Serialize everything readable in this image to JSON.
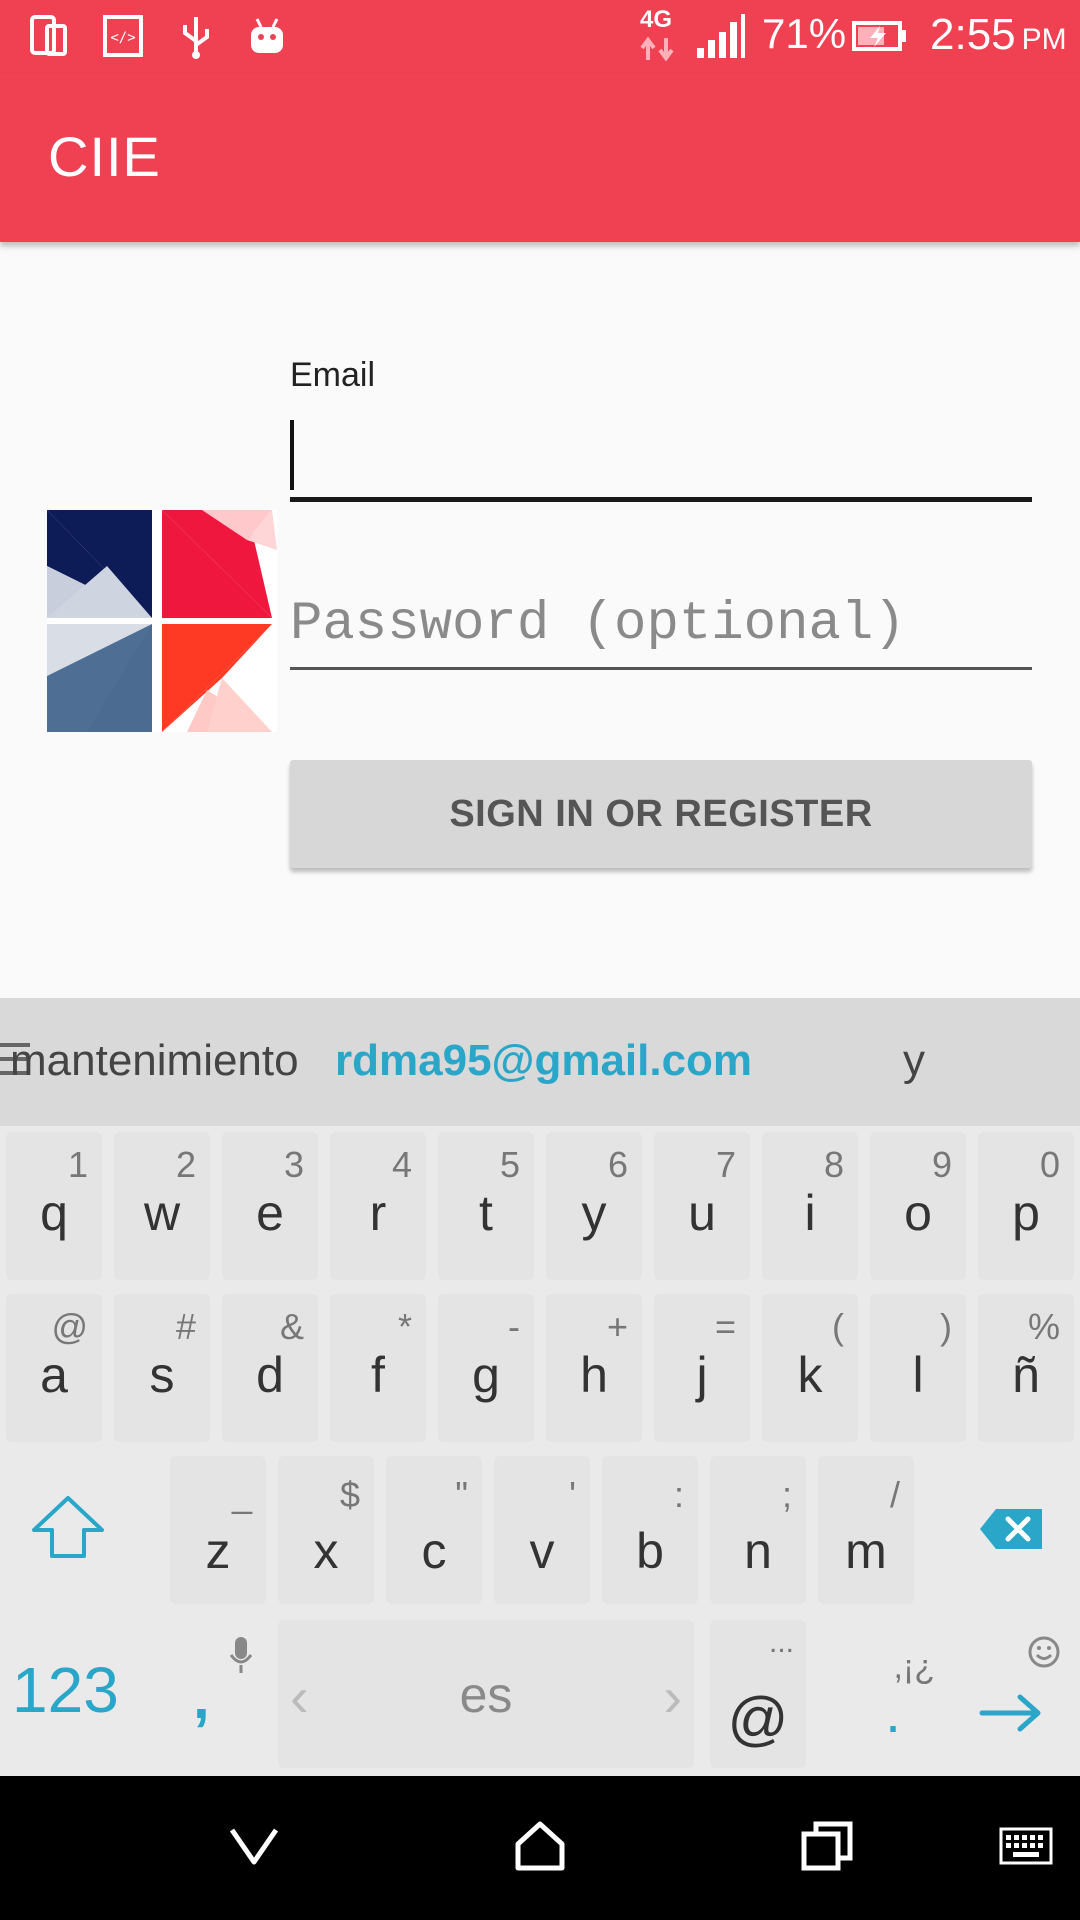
{
  "status_bar": {
    "battery_percent": "71%",
    "time": "2:55",
    "ampm": "PM",
    "network": "4G",
    "icons": [
      "device-icon",
      "code-icon",
      "usb-icon",
      "android-icon",
      "network-4g-icon",
      "signal-icon",
      "battery-charging-icon"
    ]
  },
  "app_bar": {
    "title": "CIIE"
  },
  "form": {
    "email_label": "Email",
    "email_value": "",
    "password_placeholder": "Password (optional)",
    "signin_label": "SIGN IN OR REGISTER"
  },
  "keyboard": {
    "suggestions": [
      "mantenimiento",
      "rdma95@gmail.com",
      "y"
    ],
    "row1": [
      {
        "main": "q",
        "sub": "1"
      },
      {
        "main": "w",
        "sub": "2"
      },
      {
        "main": "e",
        "sub": "3"
      },
      {
        "main": "r",
        "sub": "4"
      },
      {
        "main": "t",
        "sub": "5"
      },
      {
        "main": "y",
        "sub": "6"
      },
      {
        "main": "u",
        "sub": "7"
      },
      {
        "main": "i",
        "sub": "8"
      },
      {
        "main": "o",
        "sub": "9"
      },
      {
        "main": "p",
        "sub": "0"
      }
    ],
    "row2": [
      {
        "main": "a",
        "sub": "@"
      },
      {
        "main": "s",
        "sub": "#"
      },
      {
        "main": "d",
        "sub": "&"
      },
      {
        "main": "f",
        "sub": "*"
      },
      {
        "main": "g",
        "sub": "-"
      },
      {
        "main": "h",
        "sub": "+"
      },
      {
        "main": "j",
        "sub": "="
      },
      {
        "main": "k",
        "sub": "("
      },
      {
        "main": "l",
        "sub": ")"
      },
      {
        "main": "ñ",
        "sub": "%"
      }
    ],
    "row3": [
      {
        "main": "z",
        "sub": "_"
      },
      {
        "main": "x",
        "sub": "$"
      },
      {
        "main": "c",
        "sub": "\""
      },
      {
        "main": "v",
        "sub": "'"
      },
      {
        "main": "b",
        "sub": ":"
      },
      {
        "main": "n",
        "sub": ";"
      },
      {
        "main": "m",
        "sub": "/"
      }
    ],
    "num_label": "123",
    "comma_label": ",",
    "space_label": "es",
    "at_label": "@",
    "at_sub": "...",
    "dot_label": ".",
    "dot_sub": ",¡¿"
  },
  "nav_bar": {
    "buttons": [
      "back-icon",
      "home-icon",
      "recents-icon",
      "keyboard-switch-icon"
    ]
  },
  "colors": {
    "accent": "#ef4152",
    "keyboard_accent": "#29a6c8"
  }
}
